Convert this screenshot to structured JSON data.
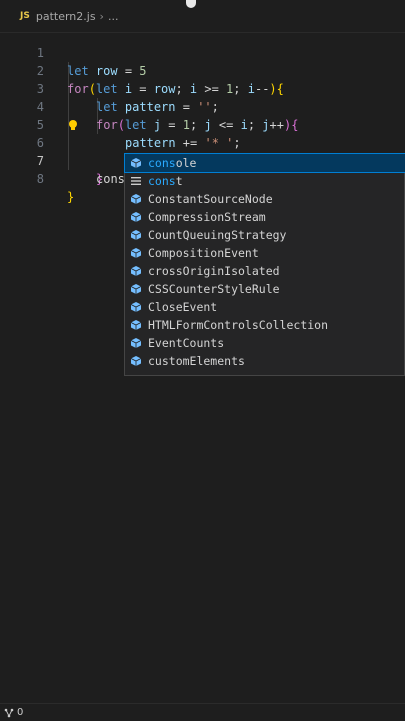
{
  "breadcrumb": {
    "badge": "JS",
    "file": "pattern2.js",
    "separator": "›",
    "ellipsis": "..."
  },
  "lines": [
    {
      "n": "1"
    },
    {
      "n": "2"
    },
    {
      "n": "3"
    },
    {
      "n": "4"
    },
    {
      "n": "5"
    },
    {
      "n": "6"
    },
    {
      "n": "7"
    },
    {
      "n": "8"
    }
  ],
  "code": {
    "l1": {
      "kw": "let",
      "name": "row",
      "rest": " = ",
      "num": "5"
    },
    "l2": {
      "kw": "for",
      "open": "(",
      "let": "let",
      "i": "i",
      "eq": " = ",
      "row": "row",
      "semi1": "; ",
      "i2": "i",
      "ge": " >= ",
      "one": "1",
      "semi2": "; ",
      "i3": "i",
      "dec": "--",
      "close": ")",
      "brace": "{"
    },
    "l3": {
      "kw": "let",
      "name": "pattern",
      "eq": " = ",
      "str": "''",
      "semi": ";"
    },
    "l4": {
      "kw": "for",
      "open": "(",
      "let": "let",
      "j": "j",
      "eq": " = ",
      "one": "1",
      "semi1": "; ",
      "j2": "j",
      "le": " <= ",
      "i": "i",
      "semi2": "; ",
      "j3": "j",
      "inc": "++",
      "close": ")",
      "brace": "{"
    },
    "l5": {
      "name": "pattern",
      "op": " += ",
      "str": "'* '",
      "semi": ";"
    },
    "l6": {
      "brace": "}"
    },
    "l7": {
      "typed": "cons"
    },
    "l8": {
      "brace": "}"
    }
  },
  "suggestions": [
    {
      "match": "cons",
      "rest": "ole",
      "icon": "cube-icon",
      "selected": true
    },
    {
      "match": "cons",
      "rest": "t",
      "icon": "keyword-icon",
      "selected": false
    },
    {
      "label": "ConstantSourceNode",
      "icon": "cube-icon",
      "selected": false
    },
    {
      "label": "CompressionStream",
      "icon": "cube-icon",
      "selected": false
    },
    {
      "label": "CountQueuingStrategy",
      "icon": "cube-icon",
      "selected": false
    },
    {
      "label": "CompositionEvent",
      "icon": "cube-icon",
      "selected": false
    },
    {
      "label": "crossOriginIsolated",
      "icon": "cube-icon",
      "selected": false
    },
    {
      "label": "CSSCounterStyleRule",
      "icon": "cube-icon",
      "selected": false
    },
    {
      "label": "CloseEvent",
      "icon": "cube-icon",
      "selected": false
    },
    {
      "label": "HTMLFormControlsCollection",
      "icon": "cube-icon",
      "selected": false
    },
    {
      "label": "EventCounts",
      "icon": "cube-icon",
      "selected": false
    },
    {
      "label": "customElements",
      "icon": "cube-icon",
      "selected": false
    }
  ],
  "status": {
    "ports": "0"
  },
  "colors": {
    "background": "#1e1e1e",
    "selection": "#04395e",
    "accent": "#007fd4",
    "match": "#2aaaff"
  }
}
